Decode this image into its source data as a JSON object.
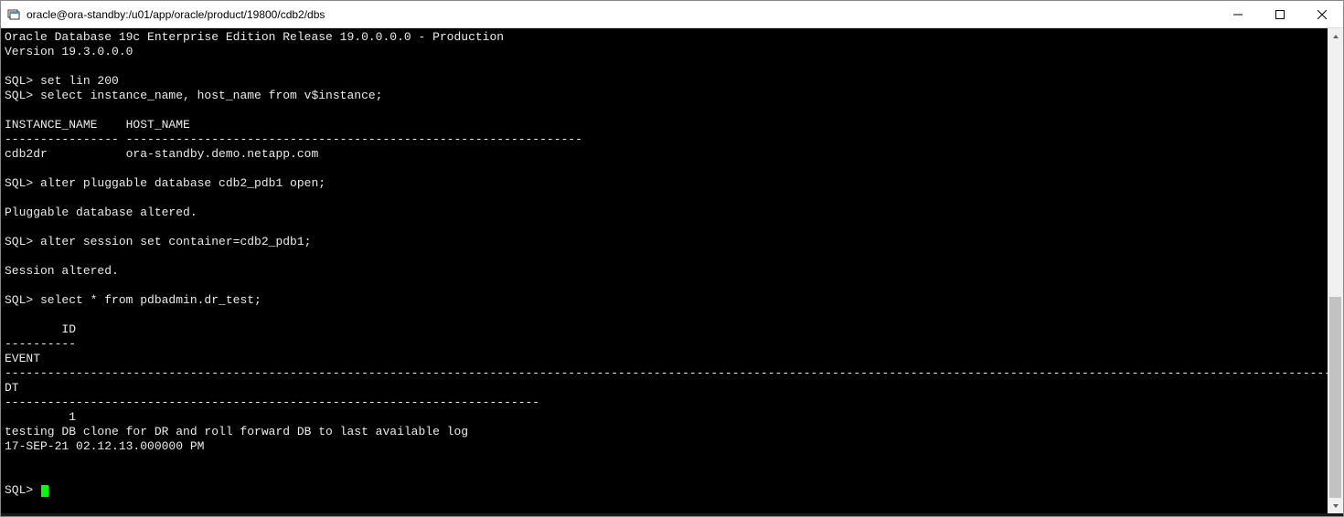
{
  "window": {
    "title": "oracle@ora-standby:/u01/app/oracle/product/19800/cdb2/dbs"
  },
  "terminal": {
    "lines": [
      "Oracle Database 19c Enterprise Edition Release 19.0.0.0.0 - Production",
      "Version 19.3.0.0.0",
      "",
      "SQL> set lin 200",
      "SQL> select instance_name, host_name from v$instance;",
      "",
      "INSTANCE_NAME    HOST_NAME",
      "---------------- ----------------------------------------------------------------",
      "cdb2dr           ora-standby.demo.netapp.com",
      "",
      "SQL> alter pluggable database cdb2_pdb1 open;",
      "",
      "Pluggable database altered.",
      "",
      "SQL> alter session set container=cdb2_pdb1;",
      "",
      "Session altered.",
      "",
      "SQL> select * from pdbadmin.dr_test;",
      "",
      "        ID",
      "----------",
      "EVENT",
      "--------------------------------------------------------------------------------------------------------------------------------------------------------------------------------------------------------",
      "DT",
      "---------------------------------------------------------------------------",
      "         1",
      "testing DB clone for DR and roll forward DB to last available log",
      "17-SEP-21 02.12.13.000000 PM",
      "",
      ""
    ],
    "prompt": "SQL> "
  }
}
